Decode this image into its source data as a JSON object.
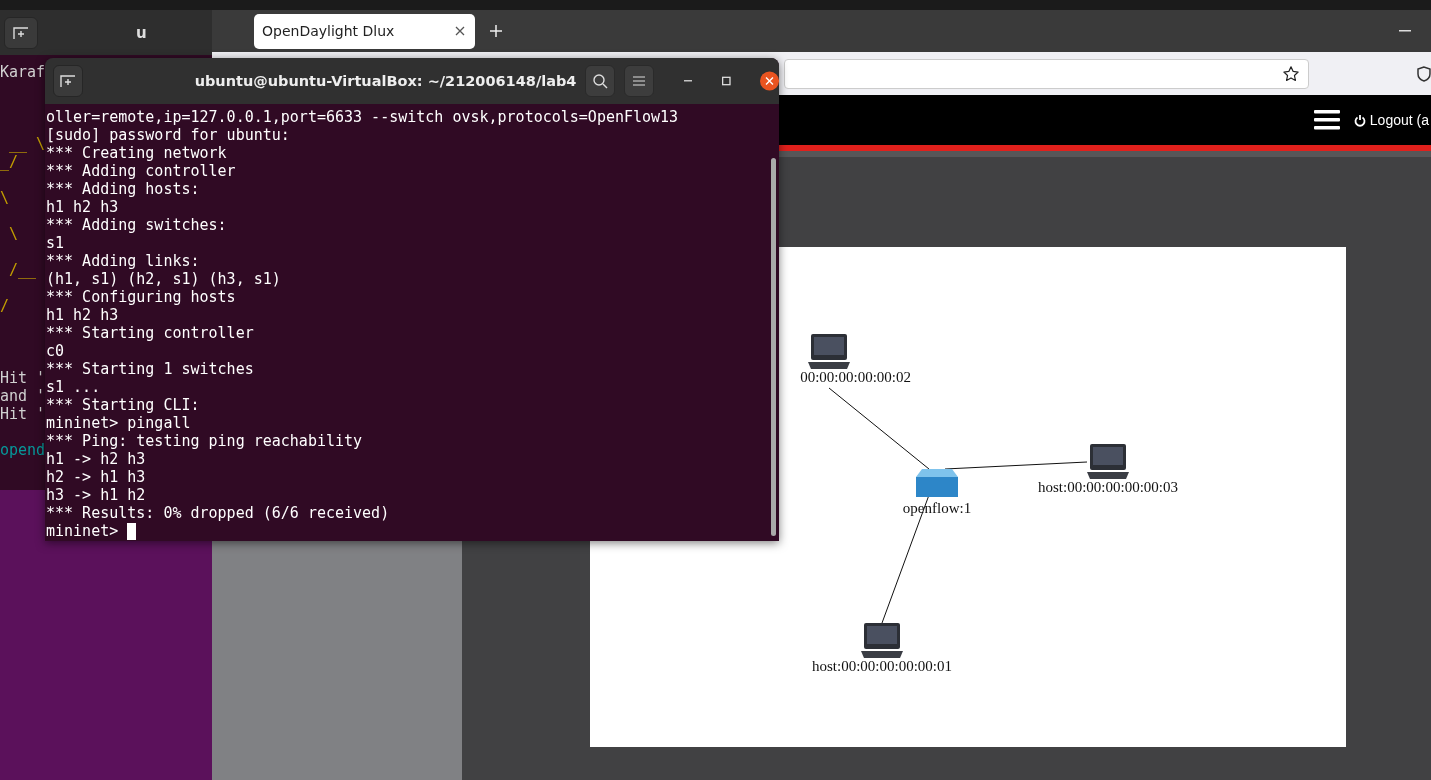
{
  "back_terminal": {
    "title": "u",
    "lines": [
      {
        "kind": "text",
        "text": "Karaf"
      },
      {
        "kind": "blank"
      },
      {
        "kind": "blank"
      },
      {
        "kind": "blank"
      },
      {
        "kind": "art",
        "text": " __ \\"
      },
      {
        "kind": "art",
        "text": "_/"
      },
      {
        "kind": "blank"
      },
      {
        "kind": "art",
        "text": "\\"
      },
      {
        "kind": "blank"
      },
      {
        "kind": "art",
        "text": " \\"
      },
      {
        "kind": "blank"
      },
      {
        "kind": "art",
        "text": " /__"
      },
      {
        "kind": "blank"
      },
      {
        "kind": "art",
        "text": "/"
      },
      {
        "kind": "blank"
      },
      {
        "kind": "blank"
      },
      {
        "kind": "blank"
      },
      {
        "kind": "text",
        "text": "Hit '"
      },
      {
        "kind": "text",
        "text": "and '"
      },
      {
        "kind": "text",
        "text": "Hit '"
      },
      {
        "kind": "blank"
      },
      {
        "kind": "prompt",
        "text": "opend"
      }
    ]
  },
  "browser": {
    "tabs": [
      {
        "label": "OpenDaylight Dlux",
        "selected": true
      }
    ],
    "page": {
      "logout": "Logout (a",
      "topology": {
        "nodes": [
          {
            "kind": "host",
            "label": "00:00:00:00:00:02"
          },
          {
            "kind": "switch",
            "label": "openflow:1"
          },
          {
            "kind": "host",
            "label": "host:00:00:00:00:00:03"
          },
          {
            "kind": "host",
            "label": "host:00:00:00:00:00:01"
          }
        ]
      }
    }
  },
  "terminal": {
    "title": "ubuntu@ubuntu-VirtualBox: ~/212006148/lab4",
    "lines": [
      "oller=remote,ip=127.0.0.1,port=6633 --switch ovsk,protocols=OpenFlow13",
      "[sudo] password for ubuntu:",
      "*** Creating network",
      "*** Adding controller",
      "*** Adding hosts:",
      "h1 h2 h3",
      "*** Adding switches:",
      "s1",
      "*** Adding links:",
      "(h1, s1) (h2, s1) (h3, s1)",
      "*** Configuring hosts",
      "h1 h2 h3",
      "*** Starting controller",
      "c0",
      "*** Starting 1 switches",
      "s1 ...",
      "*** Starting CLI:",
      "mininet> pingall",
      "*** Ping: testing ping reachability",
      "h1 -> h2 h3",
      "h2 -> h1 h3",
      "h3 -> h1 h2",
      "*** Results: 0% dropped (6/6 received)",
      "mininet>"
    ]
  }
}
